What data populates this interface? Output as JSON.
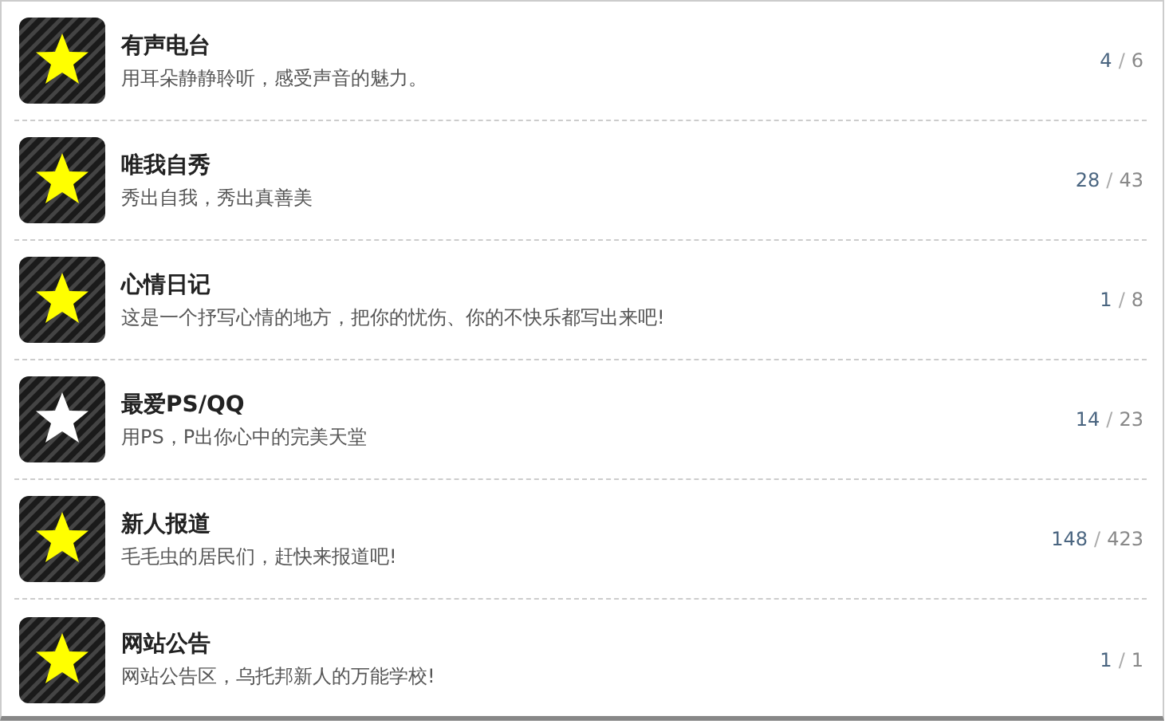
{
  "forums": [
    {
      "title": "有声电台",
      "description": "用耳朵静静聆听，感受声音的魅力。",
      "new_posts": true,
      "topics": "4",
      "separator": "/",
      "posts": "6"
    },
    {
      "title": "唯我自秀",
      "description": "秀出自我，秀出真善美",
      "new_posts": true,
      "topics": "28",
      "separator": "/",
      "posts": "43"
    },
    {
      "title": "心情日记",
      "description": "这是一个抒写心情的地方，把你的忧伤、你的不快乐都写出来吧!",
      "new_posts": true,
      "topics": "1",
      "separator": "/",
      "posts": "8"
    },
    {
      "title": "最爱PS/QQ",
      "description": "用PS，P出你心中的完美天堂",
      "new_posts": false,
      "topics": "14",
      "separator": "/",
      "posts": "23"
    },
    {
      "title": "新人报道",
      "description": "毛毛虫的居民们，赶快来报道吧!",
      "new_posts": true,
      "topics": "148",
      "separator": "/",
      "posts": "423"
    },
    {
      "title": "网站公告",
      "description": "网站公告区，乌托邦新人的万能学校!",
      "new_posts": true,
      "topics": "1",
      "separator": "/",
      "posts": "1"
    }
  ]
}
